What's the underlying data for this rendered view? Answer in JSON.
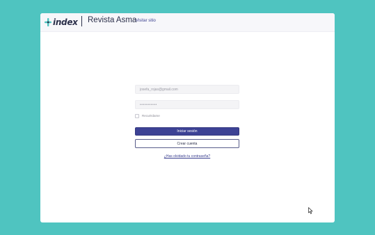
{
  "header": {
    "logo_text": "index",
    "site_title": "Revista Asma",
    "visit_link": "Visitar sitio"
  },
  "login_form": {
    "email_value": "josefa_rojas@gmail.com",
    "password_value": "•••••••••••",
    "remember_label": "Recuérdame",
    "remember_checked": false,
    "submit_label": "Iniciar sesión",
    "create_account_label": "Crear cuenta",
    "forgot_password_label": "¿Has olvidado tu contraseña?"
  },
  "colors": {
    "background": "#4fc4c0",
    "card": "#ffffff",
    "primary_button": "#3d4295",
    "logo_accent": "#4fc4c0",
    "text_dark": "#2b2f4a"
  },
  "icons": {
    "logo_mark": "plus-cross-icon",
    "pointer": "mouse-cursor-icon"
  }
}
